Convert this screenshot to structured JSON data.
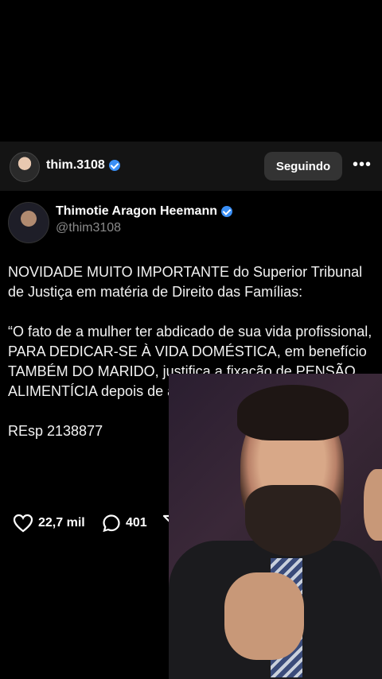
{
  "header": {
    "username": "thim.3108",
    "follow_label": "Seguindo",
    "more_label": "•••"
  },
  "post": {
    "author_name": "Thimotie Aragon Heemann",
    "author_handle": "@thim3108",
    "text": "NOVIDADE MUITO IMPORTANTE do Superior Tribunal de Justiça em matéria de Direito das Famílias:\n\n“O fato de a mulher ter abdicado de sua vida profissional, PARA DEDICAR-SE À VIDA DOMÉSTICA, em benefício TAMBÉM DO MARIDO, justifica a fixação de PENSÃO ALIMENTÍCIA depois de a separação de fato do casal”.\n\nREsp 2138877",
    "likes": "22,7 mil",
    "comments": "401"
  },
  "colors": {
    "background": "#000000",
    "header_bg": "#141414",
    "verified": "#3a8ff5",
    "follow_button": "#333333"
  },
  "icons": [
    "verified-badge-icon",
    "heart-icon",
    "comment-icon",
    "share-icon",
    "bookmark-icon",
    "more-icon"
  ]
}
